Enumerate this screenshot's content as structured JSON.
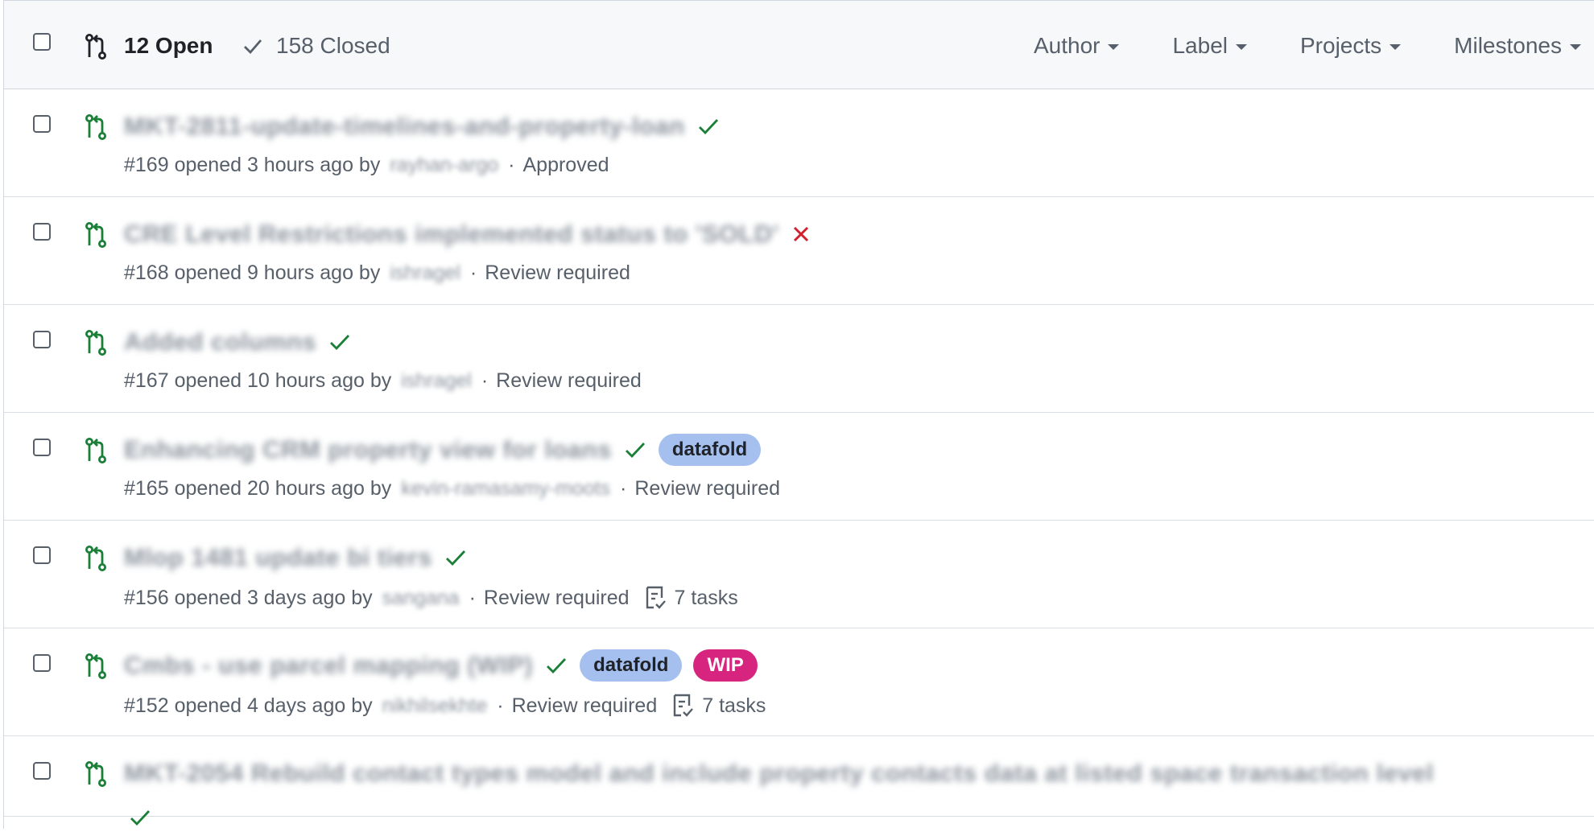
{
  "header": {
    "open_label": "12 Open",
    "closed_label": "158 Closed",
    "filters": [
      "Author",
      "Label",
      "Projects",
      "Milestones"
    ]
  },
  "colors": {
    "open_green": "#1a7f37",
    "fail_red": "#cf222e",
    "datafold_bg": "#a5c0ef",
    "wip_bg": "#d6247f"
  },
  "prs": [
    {
      "title": "MKT-2811-update-timelines-and-property-loan",
      "status": "check",
      "number": "#169",
      "opened": "opened 3 hours ago by",
      "author": "rayhan-argo",
      "review": "Approved",
      "labels": [],
      "tasks": ""
    },
    {
      "title": "CRE Level Restrictions implemented status to 'SOLD'",
      "status": "x",
      "number": "#168",
      "opened": "opened 9 hours ago by",
      "author": "ishragel",
      "review": "Review required",
      "labels": [],
      "tasks": ""
    },
    {
      "title": "Added columns",
      "status": "check",
      "number": "#167",
      "opened": "opened 10 hours ago by",
      "author": "ishragel",
      "review": "Review required",
      "labels": [],
      "tasks": ""
    },
    {
      "title": "Enhancing CRM property view for loans",
      "status": "check",
      "number": "#165",
      "opened": "opened 20 hours ago by",
      "author": "kevin-ramasamy-moots",
      "review": "Review required",
      "labels": [
        "datafold"
      ],
      "tasks": ""
    },
    {
      "title": "Mlop 1481 update bi tiers",
      "status": "check",
      "number": "#156",
      "opened": "opened 3 days ago by",
      "author": "sangana",
      "review": "Review required",
      "labels": [],
      "tasks": "7 tasks"
    },
    {
      "title": "Cmbs - use parcel mapping (WIP)",
      "status": "check",
      "number": "#152",
      "opened": "opened 4 days ago by",
      "author": "nikhilsekhte",
      "review": "Review required",
      "labels": [
        "datafold",
        "WIP"
      ],
      "tasks": "7 tasks"
    },
    {
      "title": "MKT-2054 Rebuild contact types model and include property contacts data at listed space transaction level",
      "status": "check",
      "number": "",
      "opened": "",
      "author": "",
      "review": "",
      "labels": [],
      "tasks": ""
    }
  ]
}
